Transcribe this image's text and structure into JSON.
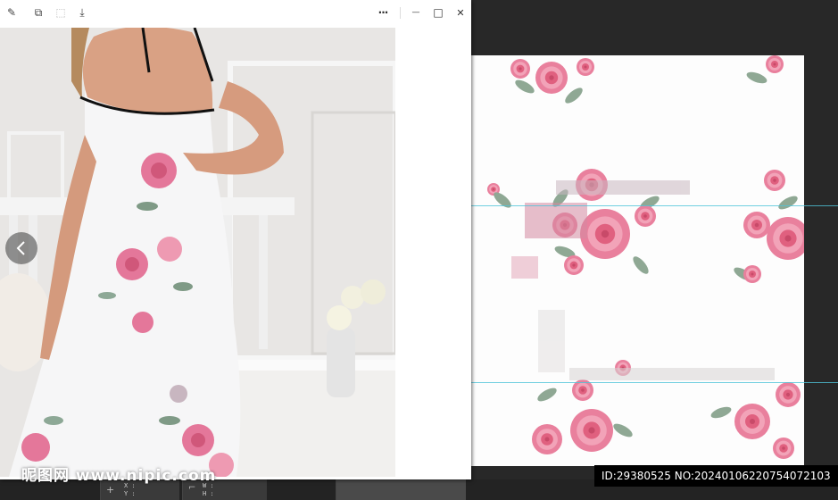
{
  "viewer": {
    "toolbar": [
      {
        "name": "edit-icon",
        "glyph": "✎"
      },
      {
        "name": "copy-window-icon",
        "glyph": "⧉"
      },
      {
        "name": "crop-icon",
        "glyph": "⬚"
      },
      {
        "name": "save-icon",
        "glyph": "⤓"
      }
    ],
    "more_glyph": "···",
    "minimize_glyph": "—",
    "maximize_glyph": "□",
    "close_glyph": "✕",
    "watermark": "昵图网 www.nipic.com"
  },
  "editor": {
    "status": {
      "x_label": "X :",
      "y_label": "Y :",
      "w_label": "W :",
      "h_label": "H :"
    },
    "id_tag": "ID:29380525 NO:20240106220754072103"
  },
  "colors": {
    "rose": "#e26a8a",
    "rose_light": "#f3a7bb",
    "leaf": "#7f9a86",
    "guide": "#4fc3d8",
    "editor_bg": "#282828"
  }
}
